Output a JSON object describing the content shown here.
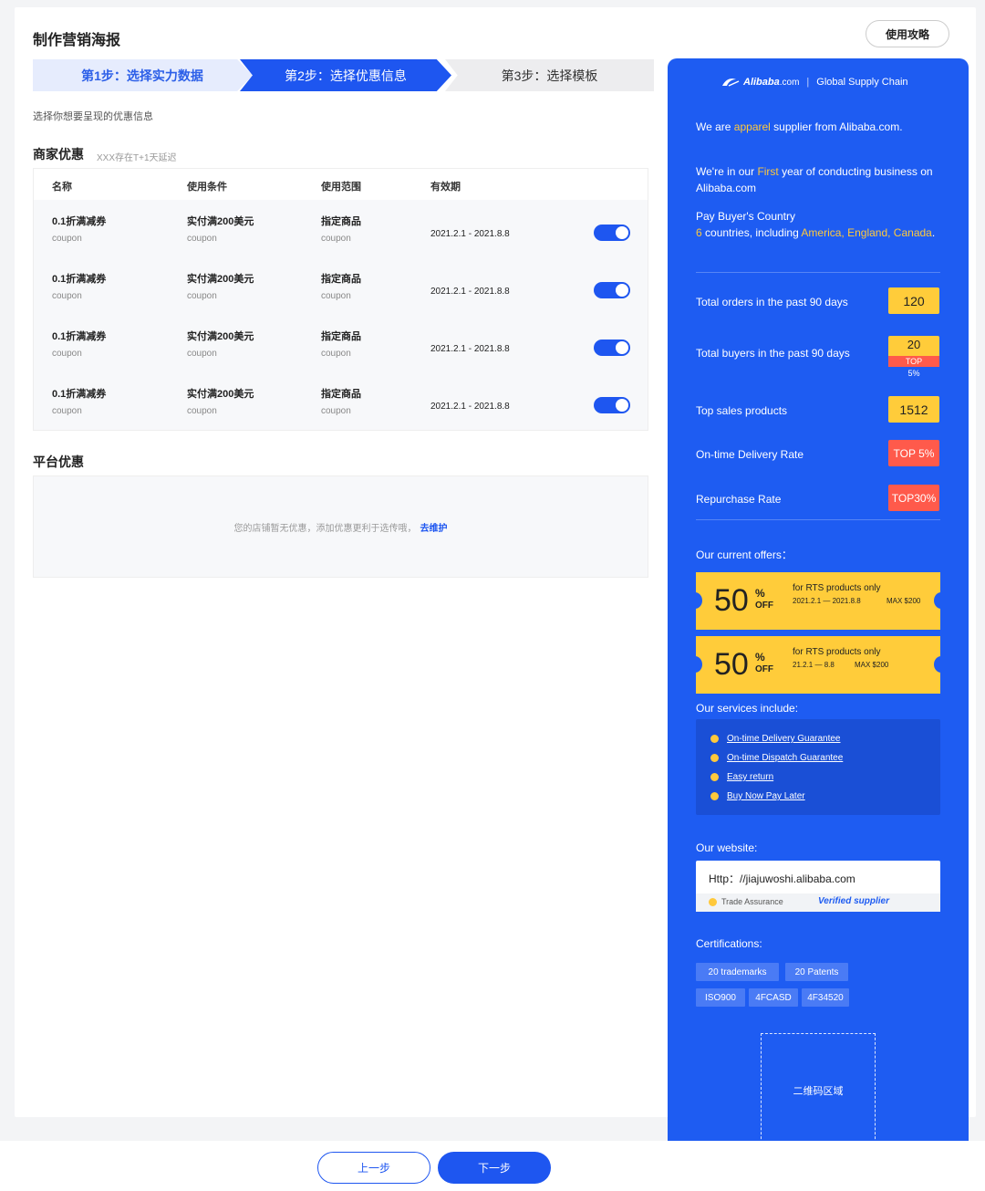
{
  "page": {
    "title": "制作营销海报",
    "guide_button": "使用攻略"
  },
  "steps": [
    {
      "label": "第1步：选择实力数据",
      "state": "done"
    },
    {
      "label": "第2步：选择优惠信息",
      "state": "active"
    },
    {
      "label": "第3步：选择模板",
      "state": "pending"
    }
  ],
  "hint": "选择你想要呈现的优惠信息",
  "merchant": {
    "title": "商家优惠",
    "note": "XXX存在T+1天延迟",
    "columns": [
      "名称",
      "使用条件",
      "使用范围",
      "有效期"
    ],
    "rows": [
      {
        "name": "0.1折满减券",
        "name_sub": "coupon",
        "cond": "实付满200美元",
        "cond_sub": "coupon",
        "scope": "指定商品",
        "scope_sub": "coupon",
        "period": "2021.2.1 - 2021.8.8",
        "enabled": true
      },
      {
        "name": "0.1折满减券",
        "name_sub": "coupon",
        "cond": "实付满200美元",
        "cond_sub": "coupon",
        "scope": "指定商品",
        "scope_sub": "coupon",
        "period": "2021.2.1 - 2021.8.8",
        "enabled": true
      },
      {
        "name": "0.1折满减券",
        "name_sub": "coupon",
        "cond": "实付满200美元",
        "cond_sub": "coupon",
        "scope": "指定商品",
        "scope_sub": "coupon",
        "period": "2021.2.1 - 2021.8.8",
        "enabled": true
      },
      {
        "name": "0.1折满减券",
        "name_sub": "coupon",
        "cond": "实付满200美元",
        "cond_sub": "coupon",
        "scope": "指定商品",
        "scope_sub": "coupon",
        "period": "2021.2.1 - 2021.8.8",
        "enabled": true
      }
    ]
  },
  "platform": {
    "title": "平台优惠",
    "empty_text": "您的店铺暂无优惠，添加优惠更利于选传哦，",
    "empty_link": "去维护"
  },
  "poster": {
    "brand_logo": "Alibaba",
    "brand_domain": ".com",
    "brand_sep": "|",
    "brand_tagline": "Global Supply Chain",
    "intro_pre": "We are ",
    "intro_hl": "apparel",
    "intro_post": " supplier from Alibaba.com.",
    "year_pre": "We're in our ",
    "year_hl": "First",
    "year_post": " year of conducting business on Alibaba.com",
    "country_title": "Pay Buyer's Country",
    "country_count": "6",
    "country_mid": " countries, including ",
    "country_hl": "America, England, Canada",
    "country_end": ".",
    "stats": {
      "orders_label": "Total orders in the past 90 days",
      "orders_value": "120",
      "buyers_label": "Total buyers in the past 90 days",
      "buyers_value": "20",
      "buyers_badge": "TOP",
      "buyers_badge_sub": "5%",
      "top_sales_label": "Top sales products",
      "top_sales_value": "1512",
      "delivery_label": "On-time Delivery Rate",
      "delivery_value": "TOP 5%",
      "repurchase_label": "Repurchase Rate",
      "repurchase_value": "TOP30%"
    },
    "offers_title": "Our current offers：",
    "coupons": [
      {
        "value": "50",
        "pct": "%",
        "off": "OFF",
        "desc": "for RTS products only",
        "dates": "2021.2.1 — 2021.8.8",
        "max": "MAX $200"
      },
      {
        "value": "50",
        "pct": "%",
        "off": "OFF",
        "desc": "for RTS products only",
        "dates": "21.2.1 — 8.8",
        "max": "MAX $200"
      }
    ],
    "services_title": "Our services include:",
    "services": [
      "On-time Delivery Guarantee",
      "On-time Dispatch Guarantee",
      "Easy return",
      "Buy Now Pay Later"
    ],
    "website_title": "Our website:",
    "website_url": "Http：//jiajuwoshi.alibaba.com",
    "trade_assurance": "Trade Assurance",
    "verified": "Verified supplier",
    "cert_title": "Certifications:",
    "certs_row1": [
      "20  trademarks",
      "20  Patents"
    ],
    "certs_row2": [
      "ISO900",
      "4FCASD",
      "4F34520"
    ],
    "qr_label": "二维码区域"
  },
  "nav": {
    "prev": "上一步",
    "next": "下一步"
  },
  "colors": {
    "primary": "#1e56f0",
    "poster_bg": "#1e5cf2",
    "highlight": "#ffcc3a",
    "badge_red": "#ff5a4b"
  }
}
